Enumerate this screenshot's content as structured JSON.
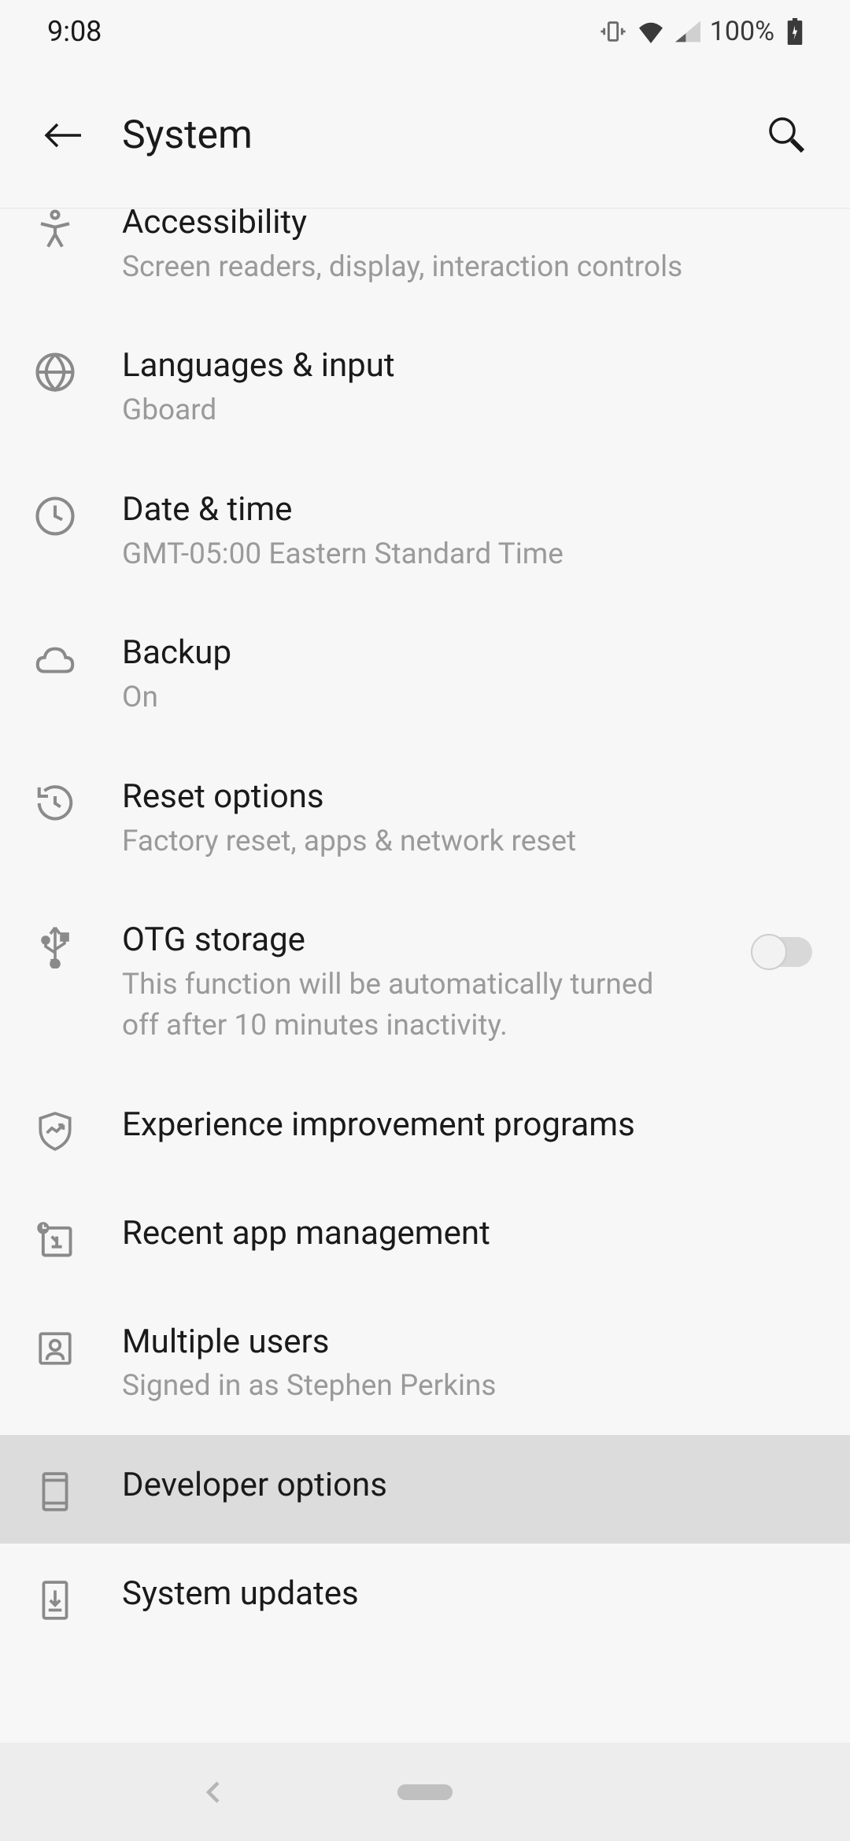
{
  "status": {
    "time": "9:08",
    "battery": "100%"
  },
  "header": {
    "title": "System"
  },
  "items": [
    {
      "title": "Accessibility",
      "subtitle": "Screen readers, display, interaction controls"
    },
    {
      "title": "Languages & input",
      "subtitle": "Gboard"
    },
    {
      "title": "Date & time",
      "subtitle": "GMT-05:00 Eastern Standard Time"
    },
    {
      "title": "Backup",
      "subtitle": "On"
    },
    {
      "title": "Reset options",
      "subtitle": "Factory reset, apps & network reset"
    },
    {
      "title": "OTG storage",
      "subtitle": "This function will be automatically turned off after 10 minutes inactivity."
    },
    {
      "title": "Experience improvement programs",
      "subtitle": ""
    },
    {
      "title": "Recent app management",
      "subtitle": ""
    },
    {
      "title": "Multiple users",
      "subtitle": "Signed in as Stephen Perkins"
    },
    {
      "title": "Developer options",
      "subtitle": ""
    },
    {
      "title": "System updates",
      "subtitle": ""
    }
  ]
}
